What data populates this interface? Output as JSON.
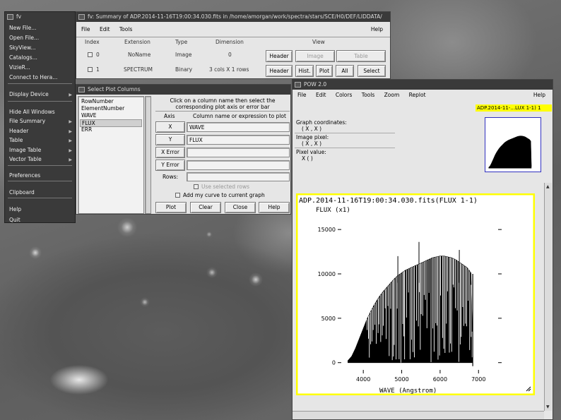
{
  "fv_menu": {
    "title": "fv",
    "items": [
      {
        "label": "New File...",
        "arrow": false
      },
      {
        "label": "Open File...",
        "arrow": false
      },
      {
        "label": "SkyView...",
        "arrow": false
      },
      {
        "label": "Catalogs...",
        "arrow": false
      },
      {
        "label": "VizieR...",
        "arrow": false
      },
      {
        "label": "Connect to Hera...",
        "arrow": false
      },
      {
        "label": "Display Device",
        "arrow": true
      },
      {
        "label": "Hide All Windows",
        "arrow": false
      },
      {
        "label": "File Summary",
        "arrow": true
      },
      {
        "label": "Header",
        "arrow": true
      },
      {
        "label": "Table",
        "arrow": true
      },
      {
        "label": "Image Table",
        "arrow": true
      },
      {
        "label": "Vector Table",
        "arrow": true
      },
      {
        "label": "Preferences",
        "arrow": false
      },
      {
        "label": "Clipboard",
        "arrow": false
      },
      {
        "label": "Help",
        "arrow": false
      },
      {
        "label": "Quit",
        "arrow": false
      }
    ]
  },
  "summary": {
    "title": "fv: Summary of ADP.2014-11-16T19:00:34.030.fits in /home/amorgan/work/spectra/stars/SCE/H0/DEF/LIDDATA/",
    "menu": [
      "File",
      "Edit",
      "Tools"
    ],
    "help": "Help",
    "columns": [
      "Index",
      "Extension",
      "Type",
      "Dimension",
      "View"
    ],
    "rows": [
      {
        "index": "0",
        "extension": "NoName",
        "type": "Image",
        "dimension": "0",
        "buttons": [
          "Header",
          "Image",
          "Table"
        ]
      },
      {
        "index": "1",
        "extension": "SPECTRUM",
        "type": "Binary",
        "dimension": "3 cols X 1 rows",
        "buttons": [
          "Header",
          "Hist.",
          "Plot",
          "All",
          "Select"
        ]
      }
    ]
  },
  "plotcols": {
    "title": "Select Plot Columns",
    "column_list": [
      "RowNumber",
      "ElementNumber",
      "WAVE",
      "FLUX",
      "ERR"
    ],
    "selected": "FLUX",
    "instruction": "Click on a column name then select the corresponding plot axis or error bar",
    "axis_header": "Axis",
    "expr_header": "Column name or expression to plot",
    "fields": [
      {
        "label": "X",
        "value": "WAVE"
      },
      {
        "label": "Y",
        "value": "FLUX"
      },
      {
        "label": "X Error",
        "value": ""
      },
      {
        "label": "Y Error",
        "value": ""
      }
    ],
    "rows_label": "Rows:",
    "use_selected": "Use selected rows",
    "add_curve": "Add my curve to current graph",
    "buttons": [
      "Plot",
      "Clear",
      "Close",
      "Help"
    ]
  },
  "pow": {
    "title": "POW 2.0",
    "menu": [
      "File",
      "Edit",
      "Colors",
      "Tools",
      "Zoom",
      "Replot"
    ],
    "help": "Help",
    "badge": "ADP.2014-11-...LUX 1-1) 1",
    "graph_coords_label": "Graph coordinates:",
    "graph_coords_value": "( X , X )",
    "image_pixel_label": "Image pixel:",
    "image_pixel_value": "( X , X )",
    "pixel_value_label": "Pixel value:",
    "pixel_value_value": "X ( )",
    "colors": {
      "highlight": "#ffff00",
      "plot_bg": "#ffffff",
      "mark": "#000000"
    }
  },
  "chart_data": {
    "type": "line",
    "title": "ADP.2014-11-16T19:00:34.030.fits(FLUX 1-1)",
    "xlabel": "WAVE (Angstrom)",
    "ylabel": "FLUX (x1)",
    "xlim": [
      3500,
      7400
    ],
    "ylim": [
      -500,
      17000
    ],
    "xticks": [
      "4000",
      "5000",
      "6000",
      "7000"
    ],
    "yticks": [
      "0",
      "5000",
      "10000",
      "15000"
    ],
    "series": [
      {
        "x": [
          3600,
          3700,
          3800,
          3900,
          4000,
          4100,
          4200,
          4300,
          4400,
          4500,
          4600,
          4700,
          4800,
          4900,
          5000,
          5100,
          5200,
          5300,
          5400,
          5500,
          5600,
          5700,
          5800,
          5900,
          6000,
          6100,
          6200,
          6300,
          6400,
          6500,
          6600,
          6700,
          6800,
          6850
        ],
        "y": [
          200,
          700,
          1600,
          2700,
          3800,
          4900,
          5800,
          6600,
          7300,
          7900,
          8400,
          8900,
          9400,
          9800,
          10100,
          10400,
          10600,
          10800,
          11000,
          11200,
          11400,
          11600,
          11800,
          11900,
          12000,
          12000,
          11900,
          11800,
          11600,
          11300,
          11000,
          10700,
          10100,
          500
        ]
      }
    ]
  }
}
